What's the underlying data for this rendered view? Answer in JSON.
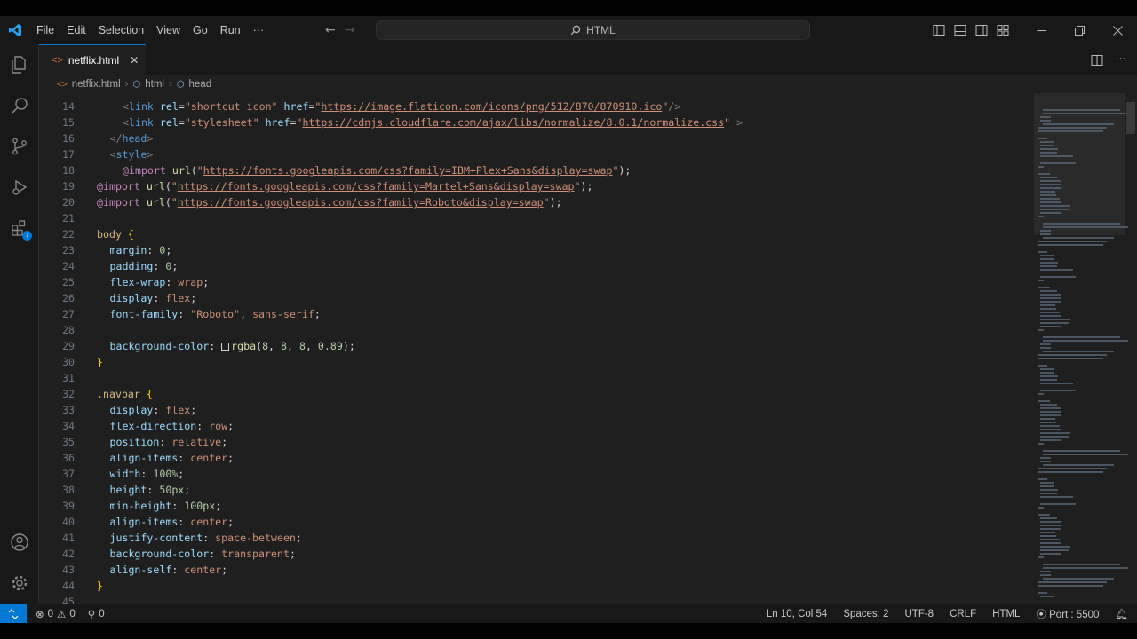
{
  "menu": {
    "items": [
      "File",
      "Edit",
      "Selection",
      "View",
      "Go",
      "Run",
      "···"
    ]
  },
  "command_center": {
    "label": "HTML",
    "icon": "search-icon"
  },
  "tab": {
    "label": "netflix.html",
    "icon": "html-file-icon",
    "close": "✕"
  },
  "breadcrumb": {
    "file": "netflix.html",
    "items": [
      "html",
      "head"
    ]
  },
  "editor": {
    "lines": [
      {
        "n": "14",
        "indent": 2,
        "tokens": [
          [
            "t-punc",
            "<"
          ],
          [
            "t-tag",
            "link"
          ],
          [
            "t-plain",
            " "
          ],
          [
            "t-attr",
            "rel"
          ],
          [
            "t-plain",
            "="
          ],
          [
            "t-str",
            "\"shortcut icon\""
          ],
          [
            "t-plain",
            " "
          ],
          [
            "t-attr",
            "href"
          ],
          [
            "t-plain",
            "="
          ],
          [
            "t-str",
            "\""
          ],
          [
            "t-url",
            "https://image.flaticon.com/icons/png/512/870/870910.ico"
          ],
          [
            "t-str",
            "\""
          ],
          [
            "t-punc",
            "/>"
          ]
        ]
      },
      {
        "n": "15",
        "indent": 2,
        "tokens": [
          [
            "t-punc",
            "<"
          ],
          [
            "t-tag",
            "link"
          ],
          [
            "t-plain",
            " "
          ],
          [
            "t-attr",
            "rel"
          ],
          [
            "t-plain",
            "="
          ],
          [
            "t-str",
            "\"stylesheet\""
          ],
          [
            "t-plain",
            " "
          ],
          [
            "t-attr",
            "href"
          ],
          [
            "t-plain",
            "="
          ],
          [
            "t-str",
            "\""
          ],
          [
            "t-url",
            "https://cdnjs.cloudflare.com/ajax/libs/normalize/8.0.1/normalize.css"
          ],
          [
            "t-str",
            "\""
          ],
          [
            "t-plain",
            " "
          ],
          [
            "t-punc",
            ">"
          ]
        ]
      },
      {
        "n": "16",
        "indent": 1,
        "tokens": [
          [
            "t-punc",
            "</"
          ],
          [
            "t-tag",
            "head"
          ],
          [
            "t-punc",
            ">"
          ]
        ]
      },
      {
        "n": "17",
        "indent": 1,
        "tokens": [
          [
            "t-punc",
            "<"
          ],
          [
            "t-tag",
            "style"
          ],
          [
            "t-punc",
            ">"
          ]
        ]
      },
      {
        "n": "18",
        "indent": 2,
        "tokens": [
          [
            "t-at",
            "@import"
          ],
          [
            "t-plain",
            " "
          ],
          [
            "t-fn",
            "url"
          ],
          [
            "t-plain",
            "("
          ],
          [
            "t-str",
            "\""
          ],
          [
            "t-url",
            "https://fonts.googleapis.com/css?family=IBM+Plex+Sans&display=swap"
          ],
          [
            "t-str",
            "\""
          ],
          [
            "t-plain",
            ");"
          ]
        ]
      },
      {
        "n": "19",
        "indent": 0,
        "tokens": [
          [
            "t-at",
            "@import"
          ],
          [
            "t-plain",
            " "
          ],
          [
            "t-fn",
            "url"
          ],
          [
            "t-plain",
            "("
          ],
          [
            "t-str",
            "\""
          ],
          [
            "t-url",
            "https://fonts.googleapis.com/css?family=Martel+Sans&display=swap"
          ],
          [
            "t-str",
            "\""
          ],
          [
            "t-plain",
            ");"
          ]
        ]
      },
      {
        "n": "20",
        "indent": 0,
        "tokens": [
          [
            "t-at",
            "@import"
          ],
          [
            "t-plain",
            " "
          ],
          [
            "t-fn",
            "url"
          ],
          [
            "t-plain",
            "("
          ],
          [
            "t-str",
            "\""
          ],
          [
            "t-url",
            "https://fonts.googleapis.com/css?family=Roboto&display=swap"
          ],
          [
            "t-str",
            "\""
          ],
          [
            "t-plain",
            ");"
          ]
        ]
      },
      {
        "n": "21",
        "indent": 0,
        "tokens": []
      },
      {
        "n": "22",
        "indent": 0,
        "tokens": [
          [
            "t-sel",
            "body"
          ],
          [
            "t-plain",
            " "
          ],
          [
            "t-brace",
            "{"
          ]
        ]
      },
      {
        "n": "23",
        "indent": 1,
        "tokens": [
          [
            "t-prop",
            "margin"
          ],
          [
            "t-plain",
            ": "
          ],
          [
            "t-num",
            "0"
          ],
          [
            "t-plain",
            ";"
          ]
        ]
      },
      {
        "n": "24",
        "indent": 1,
        "tokens": [
          [
            "t-prop",
            "padding"
          ],
          [
            "t-plain",
            ": "
          ],
          [
            "t-num",
            "0"
          ],
          [
            "t-plain",
            ";"
          ]
        ]
      },
      {
        "n": "25",
        "indent": 1,
        "tokens": [
          [
            "t-prop",
            "flex-wrap"
          ],
          [
            "t-plain",
            ": "
          ],
          [
            "t-val",
            "wrap"
          ],
          [
            "t-plain",
            ";"
          ]
        ]
      },
      {
        "n": "26",
        "indent": 1,
        "tokens": [
          [
            "t-prop",
            "display"
          ],
          [
            "t-plain",
            ": "
          ],
          [
            "t-val",
            "flex"
          ],
          [
            "t-plain",
            ";"
          ]
        ]
      },
      {
        "n": "27",
        "indent": 1,
        "tokens": [
          [
            "t-prop",
            "font-family"
          ],
          [
            "t-plain",
            ": "
          ],
          [
            "t-str",
            "\"Roboto\""
          ],
          [
            "t-plain",
            ", "
          ],
          [
            "t-val",
            "sans-serif"
          ],
          [
            "t-plain",
            ";"
          ]
        ]
      },
      {
        "n": "28",
        "indent": 0,
        "tokens": []
      },
      {
        "n": "29",
        "indent": 1,
        "tokens": [
          [
            "t-prop",
            "background-color"
          ],
          [
            "t-plain",
            ": "
          ],
          [
            "swatch",
            ""
          ],
          [
            "t-fn",
            "rgba"
          ],
          [
            "t-plain",
            "("
          ],
          [
            "t-num",
            "8"
          ],
          [
            "t-plain",
            ", "
          ],
          [
            "t-num",
            "8"
          ],
          [
            "t-plain",
            ", "
          ],
          [
            "t-num",
            "8"
          ],
          [
            "t-plain",
            ", "
          ],
          [
            "t-num",
            "0.89"
          ],
          [
            "t-plain",
            ");"
          ]
        ]
      },
      {
        "n": "30",
        "indent": 0,
        "tokens": [
          [
            "t-brace",
            "}"
          ]
        ]
      },
      {
        "n": "31",
        "indent": 0,
        "tokens": []
      },
      {
        "n": "32",
        "indent": 0,
        "tokens": [
          [
            "t-sel",
            ".navbar"
          ],
          [
            "t-plain",
            " "
          ],
          [
            "t-brace",
            "{"
          ]
        ]
      },
      {
        "n": "33",
        "indent": 1,
        "tokens": [
          [
            "t-prop",
            "display"
          ],
          [
            "t-plain",
            ": "
          ],
          [
            "t-val",
            "flex"
          ],
          [
            "t-plain",
            ";"
          ]
        ]
      },
      {
        "n": "34",
        "indent": 1,
        "tokens": [
          [
            "t-prop",
            "flex-direction"
          ],
          [
            "t-plain",
            ": "
          ],
          [
            "t-val",
            "row"
          ],
          [
            "t-plain",
            ";"
          ]
        ]
      },
      {
        "n": "35",
        "indent": 1,
        "tokens": [
          [
            "t-prop",
            "position"
          ],
          [
            "t-plain",
            ": "
          ],
          [
            "t-val",
            "relative"
          ],
          [
            "t-plain",
            ";"
          ]
        ]
      },
      {
        "n": "36",
        "indent": 1,
        "tokens": [
          [
            "t-prop",
            "align-items"
          ],
          [
            "t-plain",
            ": "
          ],
          [
            "t-val",
            "center"
          ],
          [
            "t-plain",
            ";"
          ]
        ]
      },
      {
        "n": "37",
        "indent": 1,
        "tokens": [
          [
            "t-prop",
            "width"
          ],
          [
            "t-plain",
            ": "
          ],
          [
            "t-num",
            "100%"
          ],
          [
            "t-plain",
            ";"
          ]
        ]
      },
      {
        "n": "38",
        "indent": 1,
        "tokens": [
          [
            "t-prop",
            "height"
          ],
          [
            "t-plain",
            ": "
          ],
          [
            "t-num",
            "50px"
          ],
          [
            "t-plain",
            ";"
          ]
        ]
      },
      {
        "n": "39",
        "indent": 1,
        "tokens": [
          [
            "t-prop",
            "min-height"
          ],
          [
            "t-plain",
            ": "
          ],
          [
            "t-num",
            "100px"
          ],
          [
            "t-plain",
            ";"
          ]
        ]
      },
      {
        "n": "40",
        "indent": 1,
        "tokens": [
          [
            "t-prop",
            "align-items"
          ],
          [
            "t-plain",
            ": "
          ],
          [
            "t-val",
            "center"
          ],
          [
            "t-plain",
            ";"
          ]
        ]
      },
      {
        "n": "41",
        "indent": 1,
        "tokens": [
          [
            "t-prop",
            "justify-content"
          ],
          [
            "t-plain",
            ": "
          ],
          [
            "t-val",
            "space-between"
          ],
          [
            "t-plain",
            ";"
          ]
        ]
      },
      {
        "n": "42",
        "indent": 1,
        "tokens": [
          [
            "t-prop",
            "background-color"
          ],
          [
            "t-plain",
            ": "
          ],
          [
            "t-val",
            "transparent"
          ],
          [
            "t-plain",
            ";"
          ]
        ]
      },
      {
        "n": "43",
        "indent": 1,
        "tokens": [
          [
            "t-prop",
            "align-self"
          ],
          [
            "t-plain",
            ": "
          ],
          [
            "t-val",
            "center"
          ],
          [
            "t-plain",
            ";"
          ]
        ]
      },
      {
        "n": "44",
        "indent": 0,
        "tokens": [
          [
            "t-brace",
            "}"
          ]
        ]
      },
      {
        "n": "45",
        "indent": 0,
        "tokens": []
      }
    ]
  },
  "statusbar": {
    "errors": "0",
    "warnings": "0",
    "ports_count": "0",
    "cursor": "Ln 10, Col 54",
    "spaces": "Spaces: 2",
    "encoding": "UTF-8",
    "eol": "CRLF",
    "language": "HTML",
    "port": "Port : 5500"
  },
  "colors": {
    "accent": "#0078d4",
    "background": "#1f1f1f",
    "chrome": "#181818"
  }
}
